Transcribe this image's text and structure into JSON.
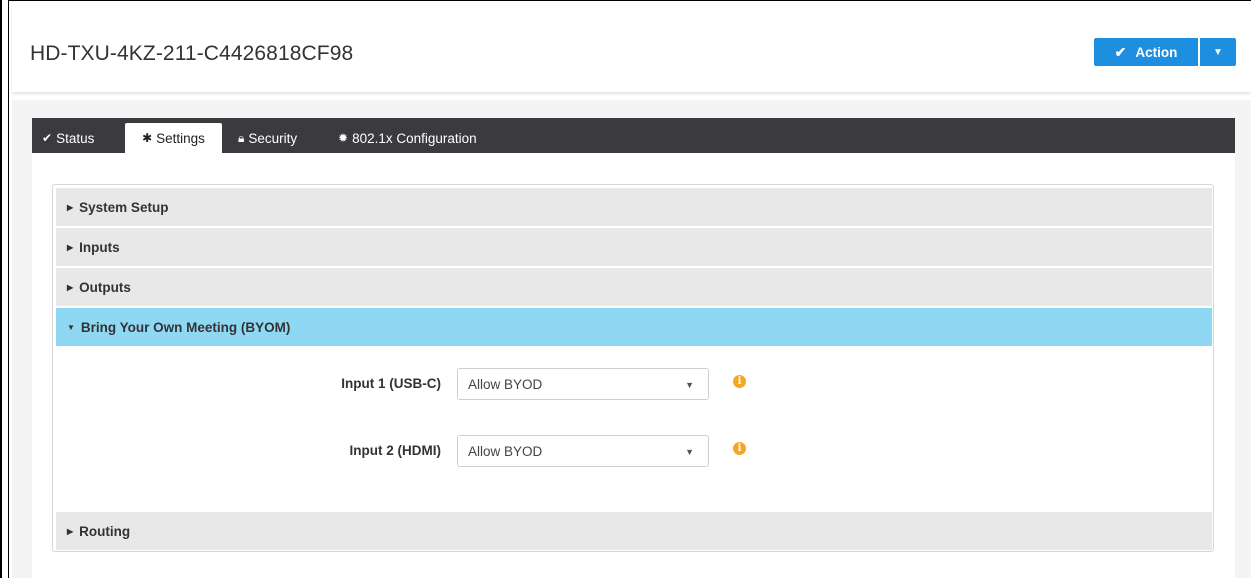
{
  "header": {
    "title": "HD-TXU-4KZ-211-C4426818CF98",
    "action_label": "Action",
    "action_icon": "check-icon",
    "accent_color": "#1e8ee0"
  },
  "tabs": [
    {
      "label": "Status",
      "icon": "check-icon",
      "active": false
    },
    {
      "label": "Settings",
      "icon": "gear-icon",
      "active": true
    },
    {
      "label": "Security",
      "icon": "lock-icon",
      "active": false
    },
    {
      "label": "802.1x Configuration",
      "icon": "cog-icon",
      "active": false
    }
  ],
  "sections": [
    {
      "label": "System Setup",
      "expanded": false
    },
    {
      "label": "Inputs",
      "expanded": false
    },
    {
      "label": "Outputs",
      "expanded": false
    },
    {
      "label": "Bring Your Own Meeting (BYOM)",
      "expanded": true
    },
    {
      "label": "Routing",
      "expanded": false
    }
  ],
  "byom": {
    "fields": [
      {
        "label": "Input 1 (USB-C)",
        "value": "Allow BYOD"
      },
      {
        "label": "Input 2 (HDMI)",
        "value": "Allow BYOD"
      }
    ],
    "info_color": "#f5a623"
  }
}
